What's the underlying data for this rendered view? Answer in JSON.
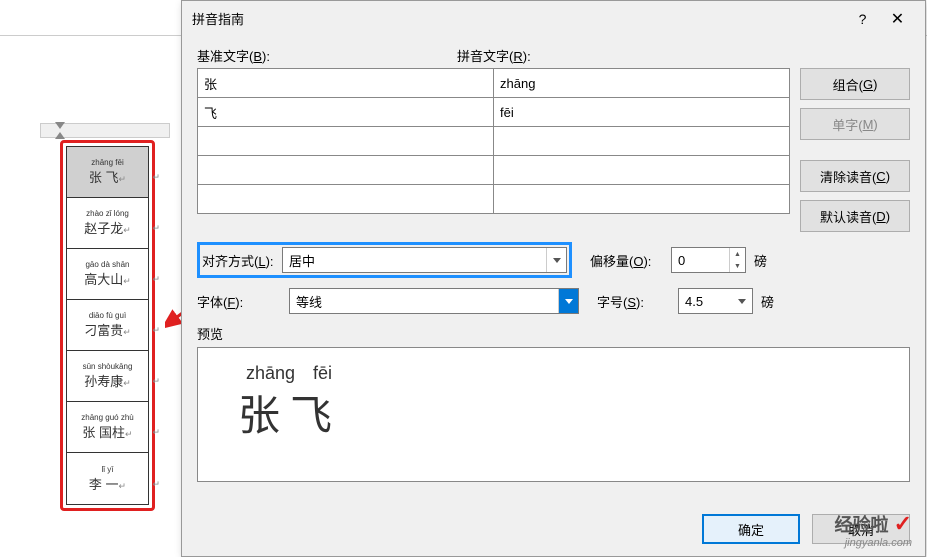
{
  "doc": {
    "cells": [
      {
        "py": "zhāng fēi",
        "ch": "张  飞",
        "hl": true
      },
      {
        "py": "zhào zǐ lóng",
        "ch": "赵子龙"
      },
      {
        "py": "gāo dà shān",
        "ch": "高大山"
      },
      {
        "py": "diāo fù guì",
        "ch": "刁富贵"
      },
      {
        "py": "sūn shòukāng",
        "ch": "孙寿康"
      },
      {
        "py": "zhāng guó zhù",
        "ch": "张 国柱"
      },
      {
        "py": "lǐ  yī",
        "ch": "李   一"
      }
    ],
    "ret": "↵"
  },
  "dialog": {
    "title": "拼音指南",
    "help": "?",
    "close": "✕",
    "base_label_pre": "基准文字(",
    "base_label_key": "B",
    "base_label_post": "):",
    "ruby_label_pre": "拼音文字(",
    "ruby_label_key": "R",
    "ruby_label_post": "):",
    "rows": [
      {
        "base": "张",
        "ruby": "zhāng"
      },
      {
        "base": "飞",
        "ruby": "fēi"
      },
      {
        "base": "",
        "ruby": ""
      },
      {
        "base": "",
        "ruby": ""
      },
      {
        "base": "",
        "ruby": ""
      }
    ],
    "buttons": {
      "combine_pre": "组合(",
      "combine_key": "G",
      "combine_post": ")",
      "single_pre": "单字(",
      "single_key": "M",
      "single_post": ")",
      "clear_pre": "清除读音(",
      "clear_key": "C",
      "clear_post": ")",
      "default_pre": "默认读音(",
      "default_key": "D",
      "default_post": ")"
    },
    "align_label_pre": "对齐方式(",
    "align_label_key": "L",
    "align_label_post": "):",
    "align_value": "居中",
    "offset_label_pre": "偏移量(",
    "offset_label_key": "O",
    "offset_label_post": "):",
    "offset_value": "0",
    "offset_unit": "磅",
    "font_label_pre": "字体(",
    "font_label_key": "F",
    "font_label_post": "):",
    "font_value": "等线",
    "size_label_pre": "字号(",
    "size_label_key": "S",
    "size_label_post": "):",
    "size_value": "4.5",
    "size_unit": "磅",
    "preview_label": "预览",
    "preview_ruby1": "zhāng",
    "preview_ruby2": "fēi",
    "preview_ch1": "张",
    "preview_ch2": "飞",
    "ok": "确定",
    "cancel": "取消"
  },
  "watermark": {
    "line1": "经验啦",
    "check": "✓",
    "line2": "jingyanla.com"
  }
}
